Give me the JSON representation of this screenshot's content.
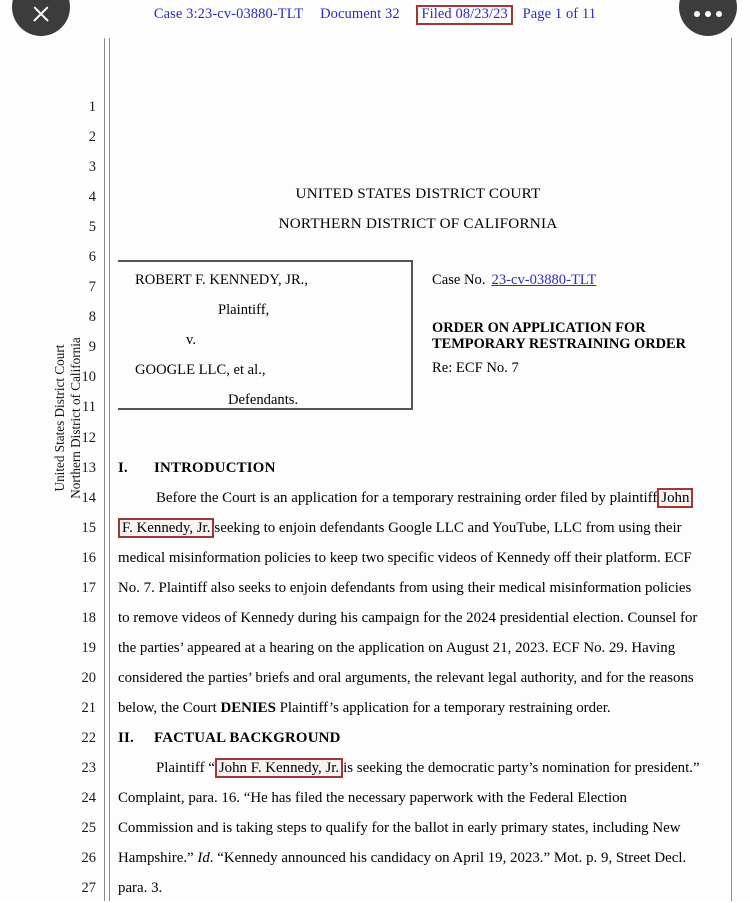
{
  "viewer": {
    "close_label": "Close",
    "more_label": "More options",
    "close_icon": "close-x-icon",
    "more_icon": "overflow-dots-icon"
  },
  "header": {
    "case": "Case 3:23-cv-03880-TLT",
    "document": "Document 32",
    "filed": "Filed 08/23/23",
    "page": "Page 1 of 11",
    "link_color": "#2c2cc0",
    "highlight_color": "#a33535"
  },
  "side_caption": {
    "line1": "United States District Court",
    "line2": "Northern District of California"
  },
  "line_numbers": [
    "1",
    "2",
    "3",
    "4",
    "5",
    "6",
    "7",
    "8",
    "9",
    "10",
    "11",
    "12",
    "13",
    "14",
    "15",
    "16",
    "17",
    "18",
    "19",
    "20",
    "21",
    "22",
    "23",
    "24",
    "25",
    "26",
    "27"
  ],
  "court": {
    "title_line_1": "UNITED STATES DISTRICT COURT",
    "title_line_2": "NORTHERN DISTRICT OF CALIFORNIA"
  },
  "caption": {
    "party_plaintiff": "ROBERT F. KENNEDY, JR.,",
    "role_plaintiff": "Plaintiff,",
    "versus": "v.",
    "party_defendant": "GOOGLE LLC, et al.,",
    "role_defendant": "Defendants.",
    "case_no_label": "Case No.",
    "case_no_value": "23-cv-03880-TLT",
    "order_title_line_1": "ORDER ON APPLICATION FOR",
    "order_title_line_2": "TEMPORARY RESTRAINING ORDER",
    "re_line": "Re: ECF No. 7"
  },
  "sections": {
    "intro_num": "I.",
    "intro_title": "INTRODUCTION",
    "facts_num": "II.",
    "facts_title": "FACTUAL BACKGROUND"
  },
  "body": {
    "l14_a": "Before the Court is an application for a temporary restraining order filed by plaintiff",
    "l14_mark": "John",
    "l15_mark": "F. Kennedy, Jr.",
    "l15_b": "seeking to enjoin defendants Google LLC and YouTube, LLC from using their",
    "l16": "medical misinformation policies to keep two specific videos of Kennedy off their platform.  ECF",
    "l17": "No. 7.  Plaintiff also seeks to enjoin defendants from using their medical misinformation policies",
    "l18": "to remove videos of Kennedy during his campaign for the 2024 presidential election.  Counsel for",
    "l19": "the parties’ appeared at a hearing on the application on August 21, 2023.  ECF No. 29.  Having",
    "l20": "considered the parties’ briefs and oral arguments, the relevant legal authority, and for the reasons",
    "l21_a": "below, the Court ",
    "l21_bold": "DENIES",
    "l21_b": " Plaintiff’s application for a temporary restraining order.",
    "l23_a": "Plaintiff “",
    "l23_mark": "John F. Kennedy, Jr.",
    "l23_b": "is seeking the democratic party’s nomination for president.”",
    "l24": "Complaint, para. 16.  “He has filed the necessary paperwork with the Federal Election",
    "l25": "Commission and is taking steps to qualify for the ballot in early primary states, including New",
    "l26_a": "Hampshire.”  ",
    "l26_it": "Id",
    "l26_b": ".  “Kennedy announced his candidacy on April 19, 2023.”  Mot. p. 9, Street Decl.",
    "l27": "para. 3."
  }
}
